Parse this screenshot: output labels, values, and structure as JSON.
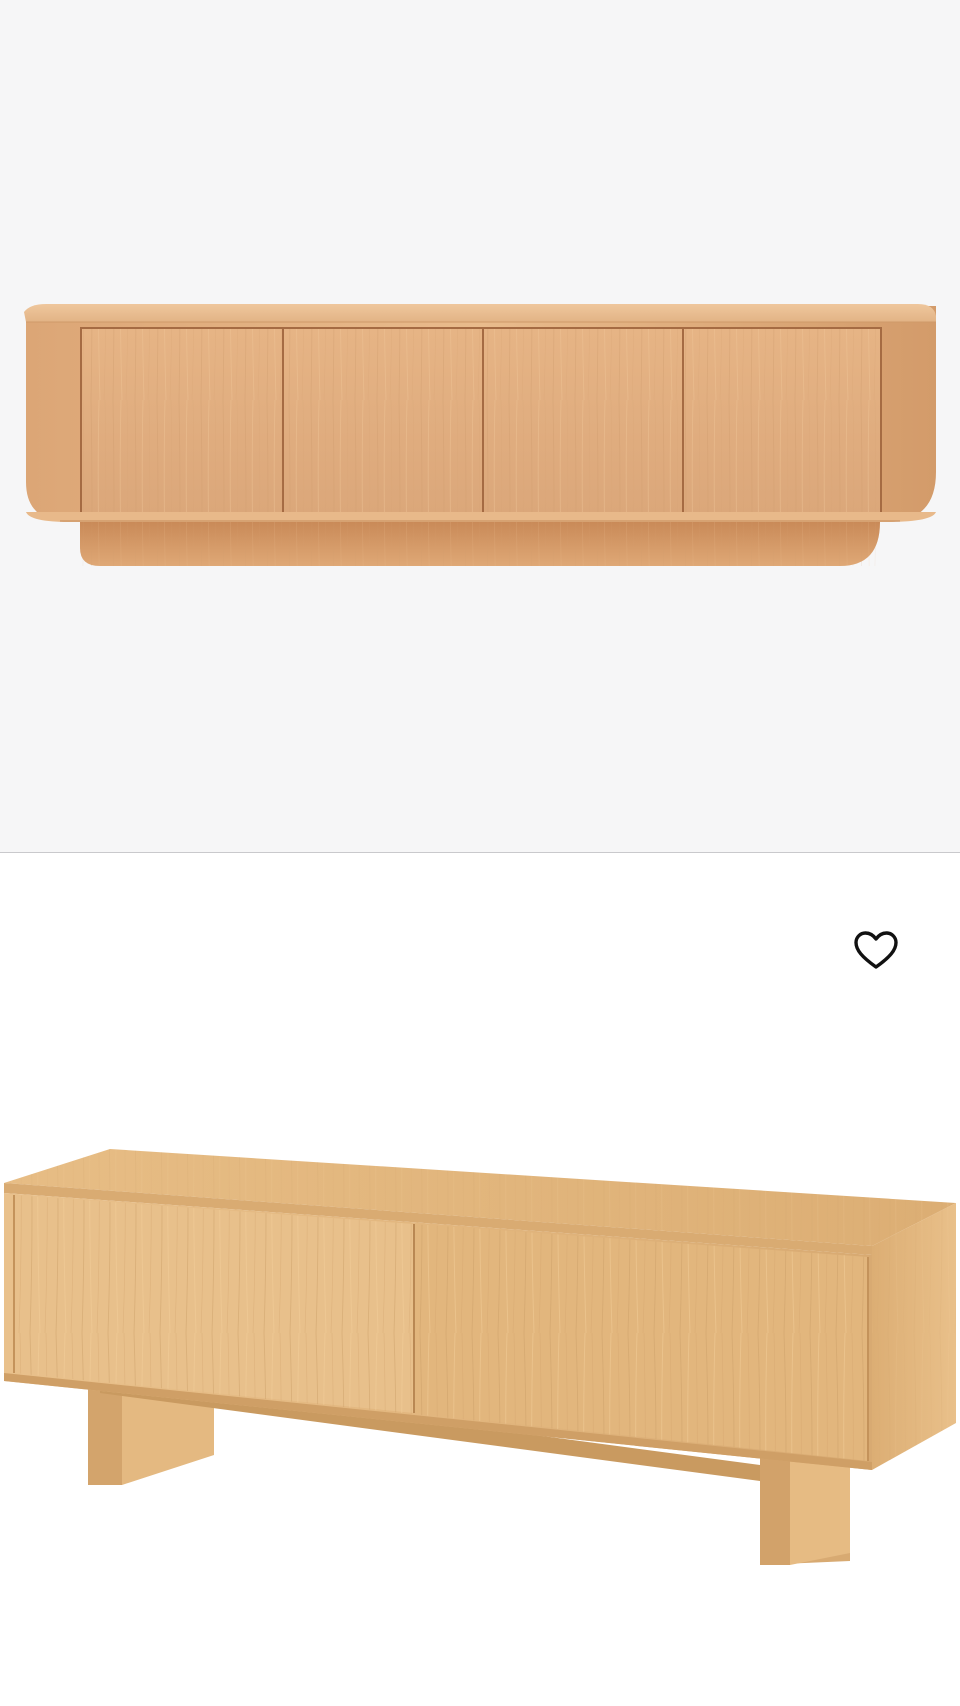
{
  "products": [
    {
      "image_subject": "rounded-oak-media-console-four-doors",
      "wood_light": "#e7ba8c",
      "wood_mid": "#dba97a",
      "wood_dark": "#c98d5e"
    },
    {
      "image_subject": "oak-tv-bench-sliding-doors",
      "wood_light": "#edc58e",
      "wood_mid": "#dfb179",
      "wood_dark": "#c79a62",
      "wishlist_icon": "heart-outline-icon"
    }
  ]
}
